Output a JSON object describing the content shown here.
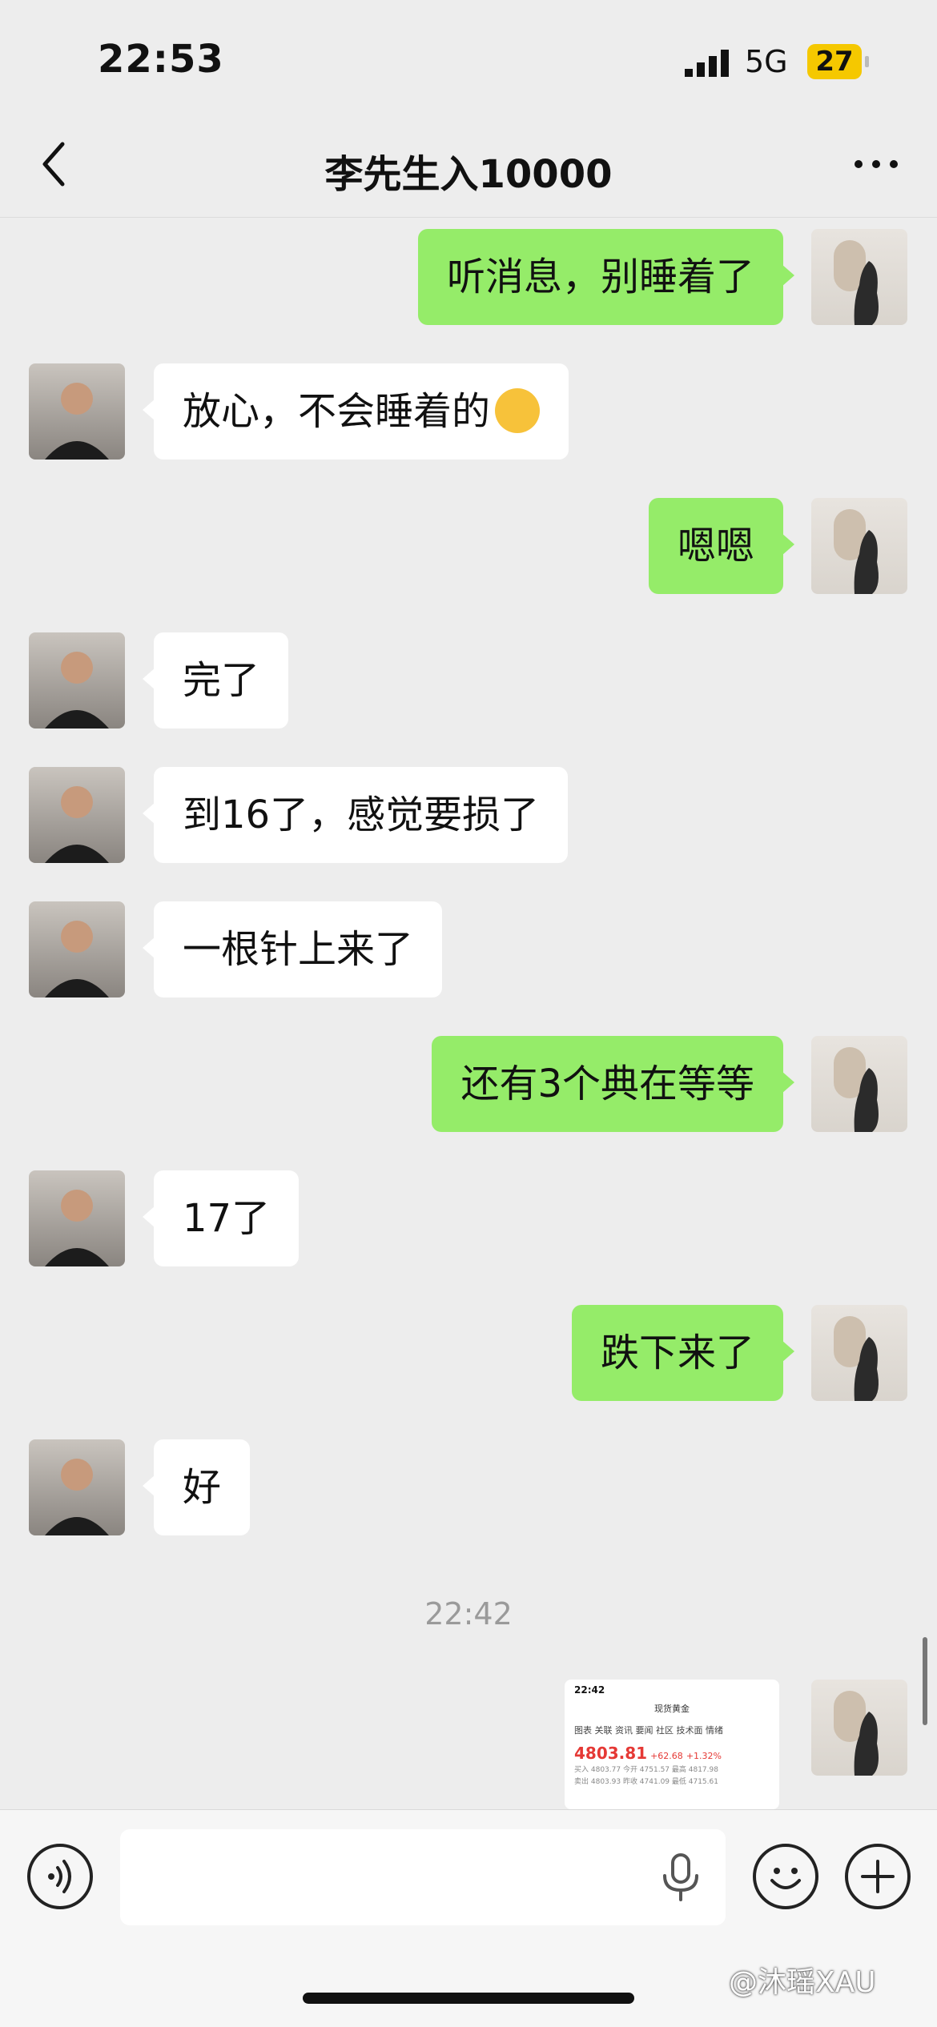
{
  "status_bar": {
    "time": "22:53",
    "network": "5G",
    "battery": "27"
  },
  "header": {
    "title": "李先生入10000",
    "back_icon": "chevron-left-icon",
    "more_icon": "more-dots-icon"
  },
  "messages": [
    {
      "from": "me",
      "text": "听消息，别睡着了"
    },
    {
      "from": "other",
      "text": "放心，不会睡着的",
      "emoji": "laughing-crying-emoji"
    },
    {
      "from": "me",
      "text": "嗯嗯"
    },
    {
      "from": "other",
      "text": "完了"
    },
    {
      "from": "other",
      "text": "到16了，感觉要损了"
    },
    {
      "from": "other",
      "text": "一根针上来了"
    },
    {
      "from": "me",
      "text": "还有3个典在等等"
    },
    {
      "from": "other",
      "text": "17了"
    },
    {
      "from": "me",
      "text": "跌下来了"
    },
    {
      "from": "other",
      "text": "好"
    }
  ],
  "timestamp": "22:42",
  "shared_image": {
    "time": "22:42",
    "title": "现货黄金",
    "tabs": "图表  关联  资讯  要闻  社区  技术面  情绪",
    "price": "4803.81",
    "change": "+62.68",
    "change_pct": "+1.32%",
    "row1": "买入 4803.77   今开 4751.57   最高 4817.98",
    "row2": "卖出 4803.93   昨收 4741.09   最低 4715.61"
  },
  "input": {
    "placeholder": ""
  },
  "watermark": "@沐瑶XAU",
  "colors": {
    "my_bubble": "#95ec69",
    "other_bubble": "#ffffff",
    "background": "#ededed"
  }
}
